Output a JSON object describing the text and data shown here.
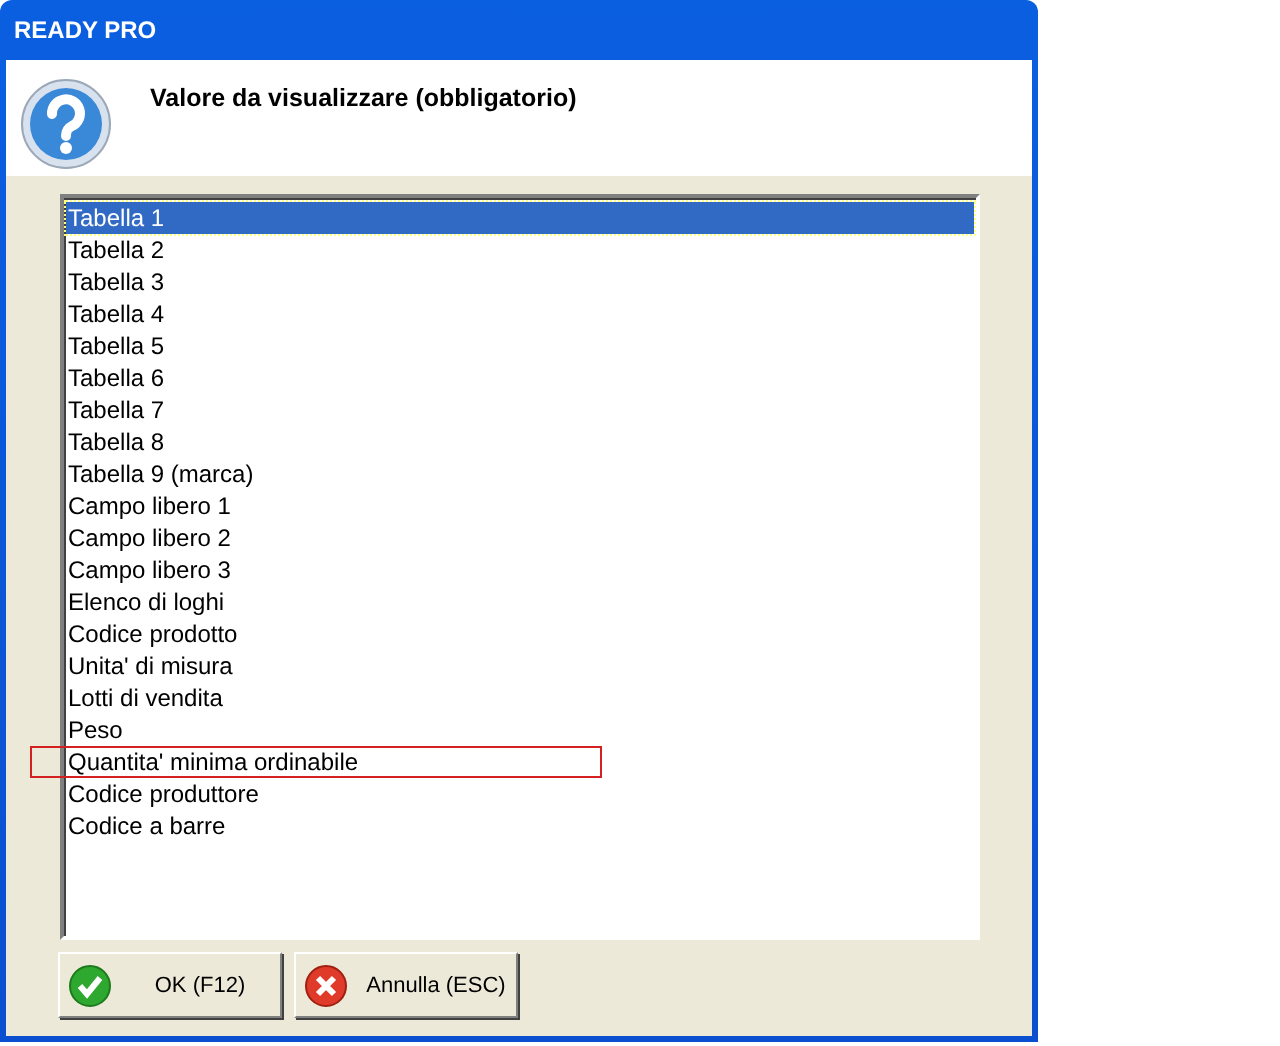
{
  "window": {
    "title": "READY PRO"
  },
  "prompt": "Valore da visualizzare (obbligatorio)",
  "items": [
    {
      "label": "Tabella 1",
      "selected": true,
      "highlighted": false
    },
    {
      "label": "Tabella 2",
      "selected": false,
      "highlighted": false
    },
    {
      "label": "Tabella 3",
      "selected": false,
      "highlighted": false
    },
    {
      "label": "Tabella 4",
      "selected": false,
      "highlighted": false
    },
    {
      "label": "Tabella 5",
      "selected": false,
      "highlighted": false
    },
    {
      "label": "Tabella 6",
      "selected": false,
      "highlighted": false
    },
    {
      "label": "Tabella 7",
      "selected": false,
      "highlighted": false
    },
    {
      "label": "Tabella 8",
      "selected": false,
      "highlighted": false
    },
    {
      "label": "Tabella 9 (marca)",
      "selected": false,
      "highlighted": false
    },
    {
      "label": "Campo libero 1",
      "selected": false,
      "highlighted": false
    },
    {
      "label": "Campo libero 2",
      "selected": false,
      "highlighted": false
    },
    {
      "label": "Campo libero 3",
      "selected": false,
      "highlighted": false
    },
    {
      "label": "Elenco di loghi",
      "selected": false,
      "highlighted": false
    },
    {
      "label": "Codice prodotto",
      "selected": false,
      "highlighted": false
    },
    {
      "label": "Unita' di misura",
      "selected": false,
      "highlighted": false
    },
    {
      "label": "Lotti di vendita",
      "selected": false,
      "highlighted": false
    },
    {
      "label": "Peso",
      "selected": false,
      "highlighted": false
    },
    {
      "label": "Quantita' minima ordinabile",
      "selected": false,
      "highlighted": true
    },
    {
      "label": "Codice produttore",
      "selected": false,
      "highlighted": false
    },
    {
      "label": "Codice a barre",
      "selected": false,
      "highlighted": false
    }
  ],
  "buttons": [
    {
      "label": "OK (F12)",
      "kind": "ok"
    },
    {
      "label": "Annulla (ESC)",
      "kind": "cancel"
    }
  ]
}
